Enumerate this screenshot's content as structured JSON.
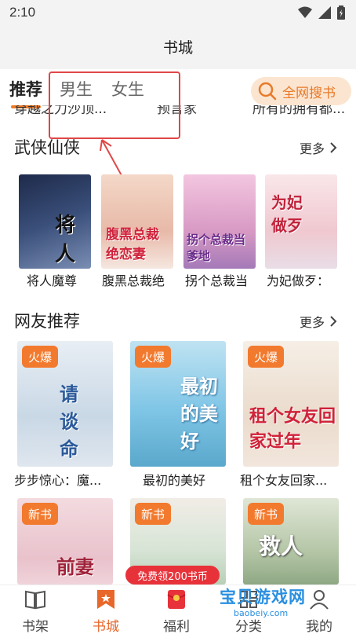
{
  "status": {
    "time": "2:10"
  },
  "header": {
    "title": "书城"
  },
  "tabs": {
    "recommend": "推荐",
    "male": "男生",
    "female": "女生"
  },
  "search": {
    "label": "全网搜书"
  },
  "prev_titles": [
    "穿越之力沙顶...",
    "预言家",
    "所有的拥有都..."
  ],
  "section1": {
    "title": "武侠仙侠",
    "more": "更多",
    "books": [
      {
        "title": "将人魔尊",
        "cover_text": "将人"
      },
      {
        "title": "腹黑总裁绝",
        "cover_text": "腹黑总裁绝恋妻"
      },
      {
        "title": "拐个总裁当",
        "cover_text": "拐个总裁当爹地"
      },
      {
        "title": "为妃做歹：",
        "cover_text": "为妃做歹"
      }
    ]
  },
  "section2": {
    "title": "网友推荐",
    "more": "更多",
    "books": [
      {
        "badge": "火爆",
        "title": "步步惊心：魔...",
        "cover_text": "请谈命"
      },
      {
        "badge": "火爆",
        "title": "最初的美好",
        "cover_text": "最初的美好"
      },
      {
        "badge": "火爆",
        "title": "租个女友回家...",
        "cover_text": "租个女友回家过年"
      }
    ]
  },
  "section3": {
    "books": [
      {
        "badge": "新书",
        "cover_text": "前妻"
      },
      {
        "badge": "新书",
        "cover_text": ""
      },
      {
        "badge": "新书",
        "cover_text": "救人"
      }
    ]
  },
  "promo": {
    "label": "免费领200书币"
  },
  "nav": {
    "shelf": "书架",
    "store": "书城",
    "welfare": "福利",
    "category": "分类",
    "mine": "我的"
  },
  "watermark": {
    "cn": "宝贝游戏网",
    "url": "baobeiy.com"
  },
  "colors": {
    "accent": "#f07c2a",
    "badge": "#f27a2e",
    "promo": "#e8323a",
    "watermark": "#2a8fe0"
  }
}
